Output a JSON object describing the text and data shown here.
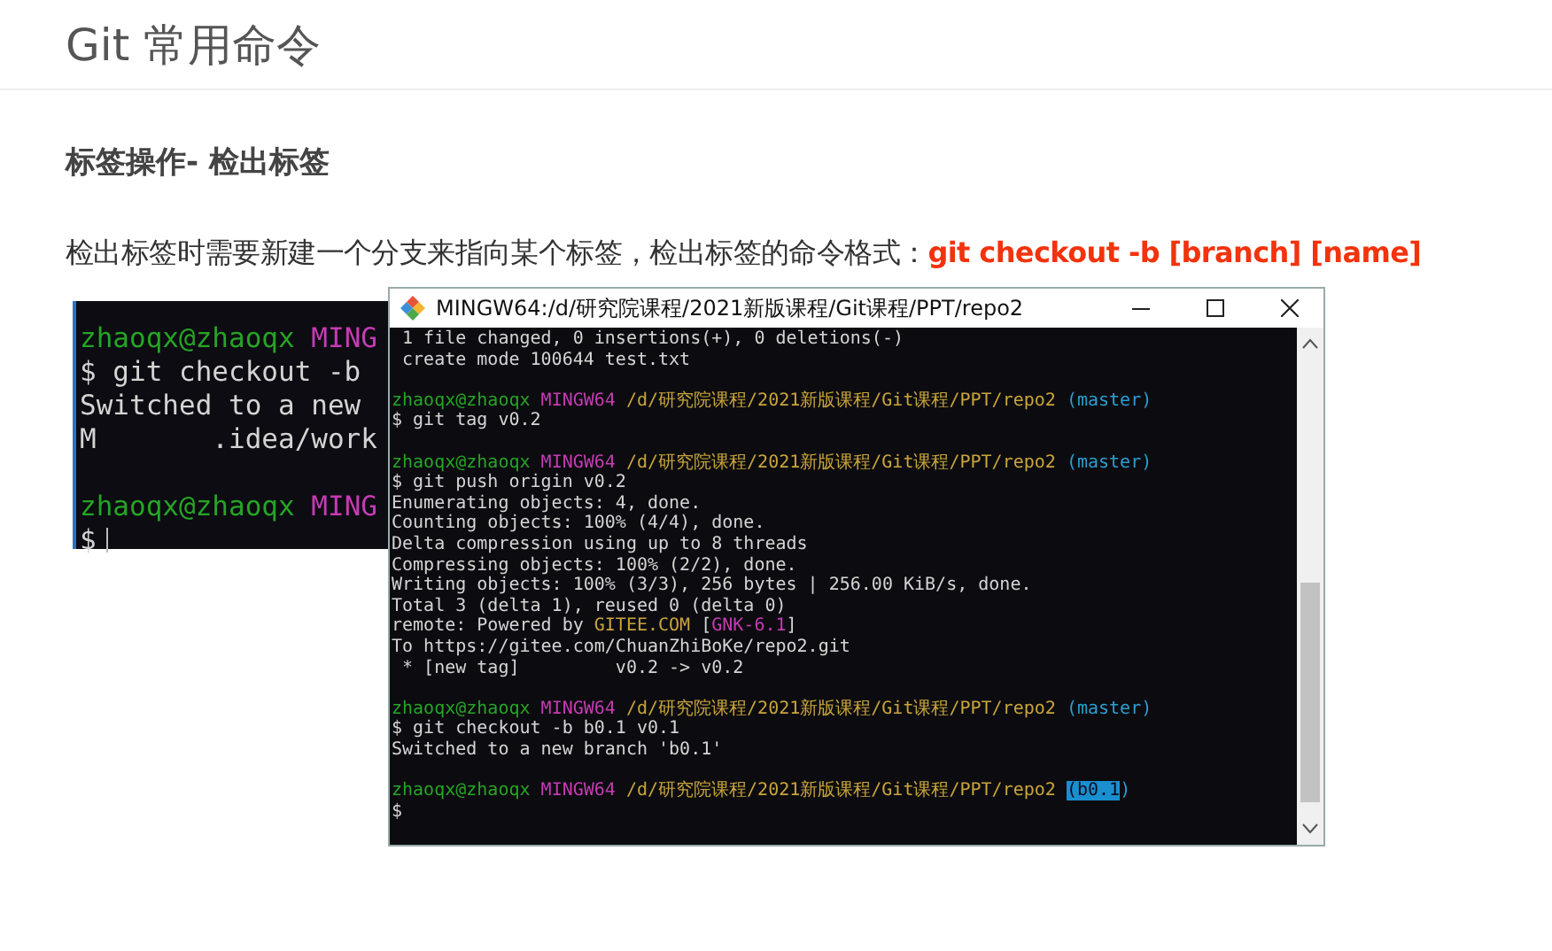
{
  "slide": {
    "title": "Git 常用命令",
    "heading": "标签操作- 检出标签",
    "text": "检出标签时需要新建一个分支来指向某个标签，检出标签的命令格式：**git checkout -b [branch] [name]**"
  },
  "back_terminal": {
    "lines": [
      {
        "segments": [
          {
            "text": "zhaoqx@zhaoqx",
            "kind": "green"
          },
          {
            "text": " MING",
            "kind": "magenta"
          }
        ]
      },
      {
        "segments": [
          {
            "text": "$ git checkout -b",
            "kind": "plain"
          }
        ]
      },
      {
        "segments": [
          {
            "text": "Switched to a new",
            "kind": "plain"
          }
        ]
      },
      {
        "segments": [
          {
            "text": "M       .idea/work",
            "kind": "plain"
          }
        ]
      },
      {
        "blank_before": true,
        "segments": [
          {
            "text": "zhaoqx@zhaoqx",
            "kind": "green"
          },
          {
            "text": " MING",
            "kind": "magenta"
          }
        ]
      },
      {
        "cursor": true,
        "segments": [
          {
            "text": "$",
            "kind": "plain"
          }
        ]
      }
    ]
  },
  "terminal_window": {
    "title": "MINGW64:/d/研究院课程/2021新版课程/Git课程/PPT/repo2",
    "lines": [
      {
        "segments": [
          {
            "text": " 1 file changed, 0 insertions(+), 0 deletions(-)",
            "kind": "plain"
          }
        ]
      },
      {
        "segments": [
          {
            "text": " create mode 100644 test.txt",
            "kind": "plain"
          }
        ]
      },
      {
        "blank_before": true,
        "segments": [
          {
            "text": "zhaoqx@zhaoqx",
            "kind": "green"
          },
          {
            "text": " MINGW64",
            "kind": "magenta"
          },
          {
            "text": " /d/研究院课程/2021新版课程/Git课程/PPT/repo2",
            "kind": "yellow"
          },
          {
            "text": " (master)",
            "kind": "cyan"
          }
        ]
      },
      {
        "segments": [
          {
            "text": "$ git tag v0.2",
            "kind": "plain"
          }
        ]
      },
      {
        "blank_before": true,
        "segments": [
          {
            "text": "zhaoqx@zhaoqx",
            "kind": "green"
          },
          {
            "text": " MINGW64",
            "kind": "magenta"
          },
          {
            "text": " /d/研究院课程/2021新版课程/Git课程/PPT/repo2",
            "kind": "yellow"
          },
          {
            "text": " (master)",
            "kind": "cyan"
          }
        ]
      },
      {
        "segments": [
          {
            "text": "$ git push origin v0.2",
            "kind": "plain"
          }
        ]
      },
      {
        "segments": [
          {
            "text": "Enumerating objects: 4, done.",
            "kind": "plain"
          }
        ]
      },
      {
        "segments": [
          {
            "text": "Counting objects: 100% (4/4), done.",
            "kind": "plain"
          }
        ]
      },
      {
        "segments": [
          {
            "text": "Delta compression using up to 8 threads",
            "kind": "plain"
          }
        ]
      },
      {
        "segments": [
          {
            "text": "Compressing objects: 100% (2/2), done.",
            "kind": "plain"
          }
        ]
      },
      {
        "segments": [
          {
            "text": "Writing objects: 100% (3/3), 256 bytes | 256.00 KiB/s, done.",
            "kind": "plain"
          }
        ]
      },
      {
        "segments": [
          {
            "text": "Total 3 (delta 1), reused 0 (delta 0)",
            "kind": "plain"
          }
        ]
      },
      {
        "segments": [
          {
            "text": "remote: Powered by ",
            "kind": "plain"
          },
          {
            "text": "GITEE.COM",
            "kind": "yellow"
          },
          {
            "text": " [",
            "kind": "plain"
          },
          {
            "text": "GNK-6.1",
            "kind": "magenta"
          },
          {
            "text": "]",
            "kind": "plain"
          }
        ]
      },
      {
        "segments": [
          {
            "text": "To https://gitee.com/ChuanZhiBoKe/repo2.git",
            "kind": "plain"
          }
        ]
      },
      {
        "segments": [
          {
            "text": " * [new tag]         v0.2 -> v0.2",
            "kind": "plain"
          }
        ]
      },
      {
        "blank_before": true,
        "segments": [
          {
            "text": "zhaoqx@zhaoqx",
            "kind": "green"
          },
          {
            "text": " MINGW64",
            "kind": "magenta"
          },
          {
            "text": " /d/研究院课程/2021新版课程/Git课程/PPT/repo2",
            "kind": "yellow"
          },
          {
            "text": " (master)",
            "kind": "cyan"
          }
        ]
      },
      {
        "segments": [
          {
            "text": "$ git checkout -b b0.1 v0.1",
            "kind": "plain"
          }
        ]
      },
      {
        "segments": [
          {
            "text": "Switched to a new branch 'b0.1'",
            "kind": "plain"
          }
        ]
      },
      {
        "blank_before": true,
        "segments": [
          {
            "text": "zhaoqx@zhaoqx",
            "kind": "green"
          },
          {
            "text": " MINGW64",
            "kind": "magenta"
          },
          {
            "text": " /d/研究院课程/2021新版课程/Git课程/PPT/repo2 ",
            "kind": "yellow"
          },
          {
            "text": "(b0.1",
            "kind": "selected"
          },
          {
            "text": ")",
            "kind": "cyan"
          }
        ]
      },
      {
        "segments": [
          {
            "text": "$",
            "kind": "plain"
          }
        ]
      }
    ]
  }
}
